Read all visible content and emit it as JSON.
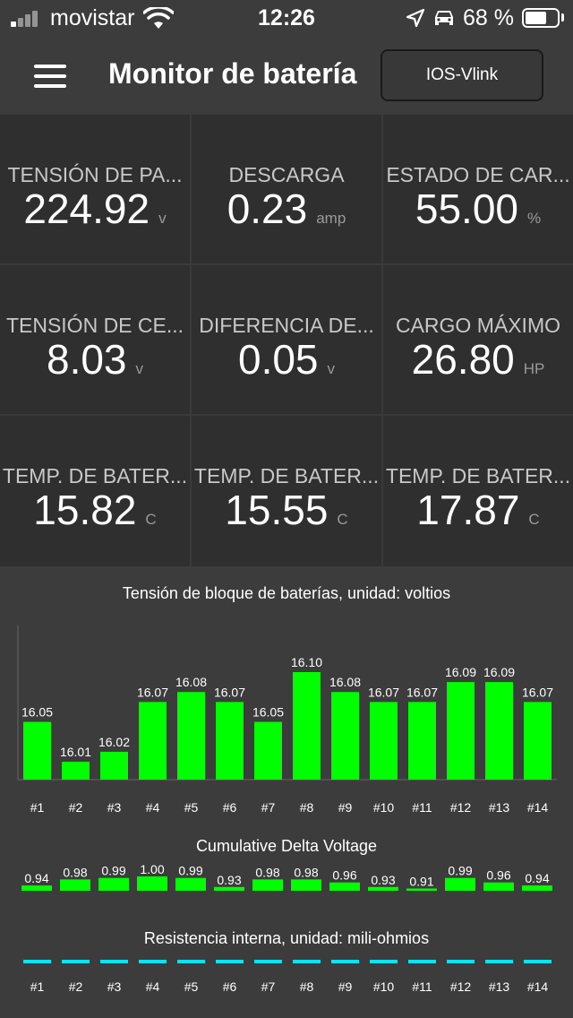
{
  "status_bar": {
    "carrier": "movistar",
    "time": "12:26",
    "battery_percent": "68 %",
    "battery_level": 0.68
  },
  "header": {
    "title": "Monitor de batería",
    "device_button": "IOS-Vlink"
  },
  "metrics": [
    {
      "label": "TENSIÓN DE PA...",
      "value": "224.92",
      "unit": "v"
    },
    {
      "label": "DESCARGA",
      "value": "0.23",
      "unit": "amp"
    },
    {
      "label": "ESTADO DE CAR...",
      "value": "55.00",
      "unit": "%"
    },
    {
      "label": "TENSIÓN DE CE...",
      "value": "8.03",
      "unit": "v"
    },
    {
      "label": "DIFERENCIA DE...",
      "value": "0.05",
      "unit": "v"
    },
    {
      "label": "CARGO MÁXIMO",
      "value": "26.80",
      "unit": "HP"
    },
    {
      "label": "TEMP. DE BATER...",
      "value": "15.82",
      "unit": "C"
    },
    {
      "label": "TEMP. DE BATER...",
      "value": "15.55",
      "unit": "C"
    },
    {
      "label": "TEMP. DE BATER...",
      "value": "17.87",
      "unit": "C"
    }
  ],
  "colors": {
    "bar": "#00ff00",
    "resistance_line": "#00e5ff"
  },
  "chart_data": [
    {
      "type": "bar",
      "title": "Tensión de bloque de baterías, unidad: voltios",
      "categories": [
        "#1",
        "#2",
        "#3",
        "#4",
        "#5",
        "#6",
        "#7",
        "#8",
        "#9",
        "#10",
        "#11",
        "#12",
        "#13",
        "#14"
      ],
      "values": [
        16.05,
        16.01,
        16.02,
        16.07,
        16.08,
        16.07,
        16.05,
        16.1,
        16.08,
        16.07,
        16.07,
        16.09,
        16.09,
        16.07
      ],
      "labels": [
        "16.05",
        "16.01",
        "16.02",
        "16.07",
        "16.08",
        "16.07",
        "16.05",
        "16.10",
        "16.08",
        "16.07",
        "16.07",
        "16.09",
        "16.09",
        "16.07"
      ]
    },
    {
      "type": "bar",
      "title": "Cumulative Delta Voltage",
      "categories": [
        "#1",
        "#2",
        "#3",
        "#4",
        "#5",
        "#6",
        "#7",
        "#8",
        "#9",
        "#10",
        "#11",
        "#12",
        "#13",
        "#14"
      ],
      "values": [
        0.94,
        0.98,
        0.99,
        1.0,
        0.99,
        0.93,
        0.98,
        0.98,
        0.96,
        0.93,
        0.91,
        0.99,
        0.96,
        0.94
      ],
      "labels": [
        "0.94",
        "0.98",
        "0.99",
        "1.00",
        "0.99",
        "0.93",
        "0.98",
        "0.98",
        "0.96",
        "0.93",
        "0.91",
        "0.99",
        "0.96",
        "0.94"
      ]
    },
    {
      "type": "bar",
      "title": "Resistencia interna, unidad: mili-ohmios",
      "categories": [
        "#1",
        "#2",
        "#3",
        "#4",
        "#5",
        "#6",
        "#7",
        "#8",
        "#9",
        "#10",
        "#11",
        "#12",
        "#13",
        "#14"
      ],
      "values": [
        0,
        0,
        0,
        0,
        0,
        0,
        0,
        0,
        0,
        0,
        0,
        0,
        0,
        0
      ]
    }
  ]
}
